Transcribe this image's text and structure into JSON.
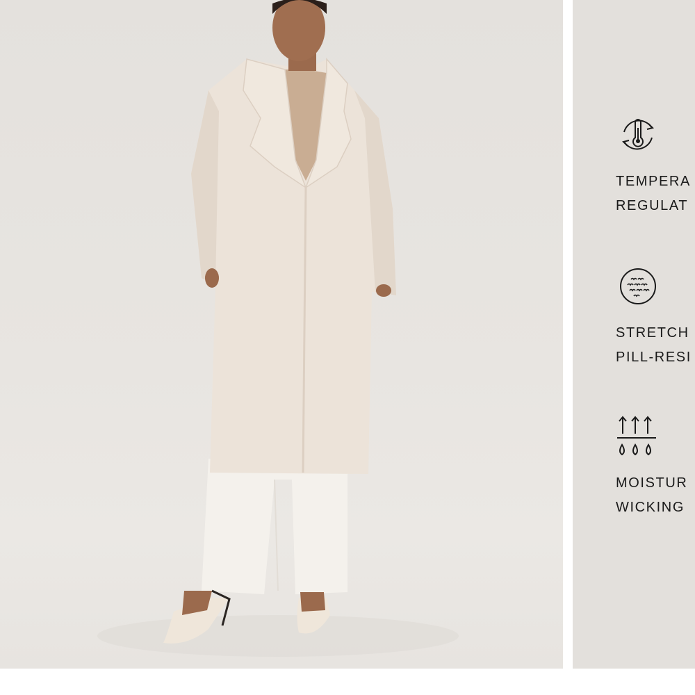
{
  "product": {
    "image_alt": "Model wearing a long cream wool coat over a tan sweater with white trousers and white slingback heels"
  },
  "features": [
    {
      "icon": "thermometer-cycle-icon",
      "line1": "TEMPERA",
      "line2": "REGULAT"
    },
    {
      "icon": "stretch-fabric-icon",
      "line1": "STRETCH",
      "line2": "PILL-RESI"
    },
    {
      "icon": "moisture-wicking-icon",
      "line1": "MOISTUR",
      "line2": "WICKING"
    }
  ],
  "colors": {
    "photo_background": "#e6e3df",
    "panel_background": "#e3e0dc",
    "text": "#1a1a1a",
    "coat": "#ece3d9",
    "sweater": "#c9ad93"
  }
}
